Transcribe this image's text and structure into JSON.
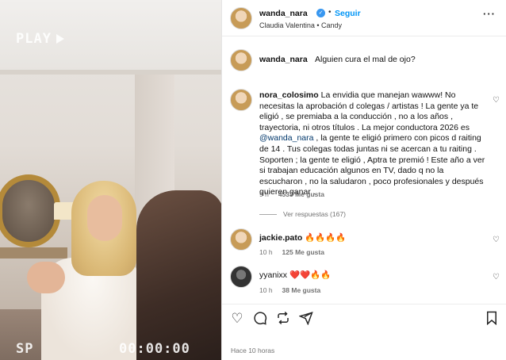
{
  "media": {
    "overlay_play": "PLAY",
    "overlay_mode": "SP",
    "overlay_timecode": "00:00:00"
  },
  "post": {
    "author": "wanda_nara",
    "follow_label": "Seguir",
    "subtitle": "Claudia Valentina • Candy",
    "caption": "Alguien cura el mal de ojo?",
    "date": "Hace 10 horas"
  },
  "comments": [
    {
      "user": "nora_colosimo",
      "text_before": "La envidia que manejan wawww! No necesitas la aprobación d colegas / artistas ! La gente ya te eligió , se premiaba a la conducción , no a los años , trayectoria, ni otros títulos . La mejor conductora 2026 es ",
      "mention": "@wanda_nara",
      "text_after": " , la gente te eligió primero con picos d raiting de 14 . Tus colegas todas juntas ni se acercan a tu raiting . Soporten ; la gente te eligió , Aptra te premió ! Este año a ver si trabajan educación algunos en TV, dado q no la escucharon , no la saludaron , poco profesionales y después quieren ganar .",
      "time": "9 h",
      "likes": "4533 Me gusta",
      "replies": "Ver respuestas (167)"
    },
    {
      "user": "jackie.pato",
      "text": "🔥🔥🔥🔥",
      "time": "10 h",
      "likes": "125 Me gusta"
    },
    {
      "user": "yyanixx",
      "text": "❤️❤️🔥🔥",
      "time": "10 h",
      "likes": "38 Me gusta"
    }
  ],
  "icons": {
    "like": "heart-icon",
    "comment": "comment-icon",
    "repost": "repost-icon",
    "share": "share-icon",
    "save": "bookmark-icon"
  },
  "colors": {
    "follow": "#0095f6",
    "verified": "#3897f0",
    "muted": "#737373"
  }
}
